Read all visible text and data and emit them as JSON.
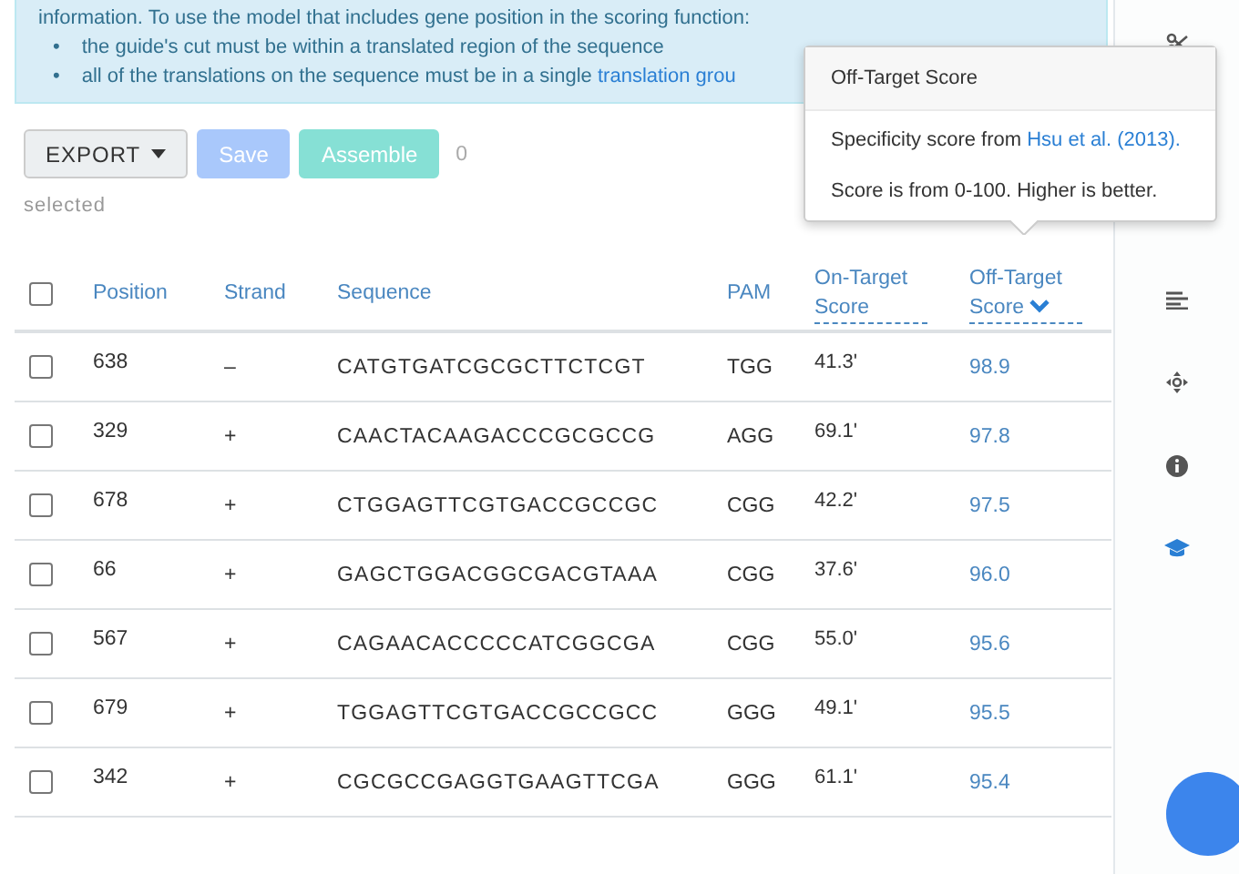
{
  "notice": {
    "intro": "information. To use the model that includes gene position in the scoring function:",
    "bullets": [
      {
        "marker": "•",
        "text": "the guide's cut must be within a translated region of the sequence"
      },
      {
        "marker": "•",
        "text": "all of the translations on the sequence must be in a single ",
        "link": "translation grou"
      }
    ]
  },
  "toolbar": {
    "export": "EXPORT",
    "save": {
      "label": "Save",
      "disabled": true
    },
    "assemble": {
      "label": "Assemble",
      "disabled": true
    },
    "count": "0",
    "count_label": "selected"
  },
  "table": {
    "columns": [
      {
        "label": "Position",
        "underlined": false,
        "sorted": false
      },
      {
        "label": "Strand",
        "underlined": false,
        "sorted": false
      },
      {
        "label": "Sequence",
        "underlined": false,
        "sorted": false
      },
      {
        "label": "PAM",
        "underlined": false,
        "sorted": false
      },
      {
        "label": "On-Target Score",
        "underlined": true,
        "sorted": false
      },
      {
        "label": "Off-Target Score",
        "underlined": true,
        "sorted": true
      }
    ],
    "all_checked": false,
    "rows": [
      {
        "checked": false,
        "cells": [
          "638",
          "–",
          "CATGTGATCGCGCTTCTCGT",
          "TGG",
          "41.3'",
          "98.9"
        ]
      },
      {
        "checked": false,
        "cells": [
          "329",
          "+",
          "CAACTACAAGACCCGCGCCG",
          "AGG",
          "69.1'",
          "97.8"
        ]
      },
      {
        "checked": false,
        "cells": [
          "678",
          "+",
          "CTGGAGTTCGTGACCGCCGC",
          "CGG",
          "42.2'",
          "97.5"
        ]
      },
      {
        "checked": false,
        "cells": [
          "66",
          "+",
          "GAGCTGGACGGCGACGTAAA",
          "CGG",
          "37.6'",
          "96.0"
        ]
      },
      {
        "checked": false,
        "cells": [
          "567",
          "+",
          "CAGAACACCCCCATCGGCGA",
          "CGG",
          "55.0'",
          "95.6"
        ]
      },
      {
        "checked": false,
        "cells": [
          "679",
          "+",
          "TGGAGTTCGTGACCGCCGCC",
          "GGG",
          "49.1'",
          "95.5"
        ]
      },
      {
        "checked": false,
        "cells": [
          "342",
          "+",
          "CGCGCCGAGGTGAAGTTCGA",
          "GGG",
          "61.1'",
          "95.4"
        ]
      }
    ]
  },
  "popover": {
    "title": "Off-Target Score",
    "line_1": "Specificity score from ",
    "link": "Hsu et al. (2013).",
    "line_2": "Score is from 0-100. Higher is better."
  },
  "sidebar": {
    "tools": [
      {
        "kind": "cut",
        "active": false
      },
      {
        "kind": "lines",
        "active": false
      },
      {
        "kind": "move",
        "active": false
      },
      {
        "kind": "info",
        "active": false
      },
      {
        "kind": "learn",
        "active": true
      }
    ]
  }
}
